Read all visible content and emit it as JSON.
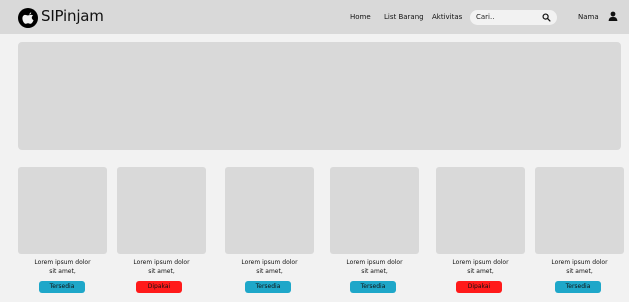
{
  "header": {
    "brand": "SIPinjam",
    "nav": [
      "Home",
      "List Barang",
      "Aktivitas"
    ],
    "search_placeholder": "Cari..",
    "user_name": "Nama"
  },
  "colors": {
    "available": "#1ea7c9",
    "borrowed": "#ff1a1a"
  },
  "cards": [
    {
      "line1": "Lorem ipsum dolor",
      "line2": "sit amet,",
      "status": "Tersedia",
      "status_type": "available"
    },
    {
      "line1": "Lorem ipsum dolor",
      "line2": "sit amet,",
      "status": "Dipakai",
      "status_type": "borrowed"
    },
    {
      "line1": "Lorem ipsum dolor",
      "line2": "sit amet,",
      "status": "Tersedia",
      "status_type": "available"
    },
    {
      "line1": "Lorem ipsum dolor",
      "line2": "sit amet,",
      "status": "Tersedia",
      "status_type": "available"
    },
    {
      "line1": "Lorem ipsum dolor",
      "line2": "sit amet,",
      "status": "Dipakai",
      "status_type": "borrowed"
    },
    {
      "line1": "Lorem ipsum dolor",
      "line2": "sit amet,",
      "status": "Tersedia",
      "status_type": "available"
    }
  ]
}
